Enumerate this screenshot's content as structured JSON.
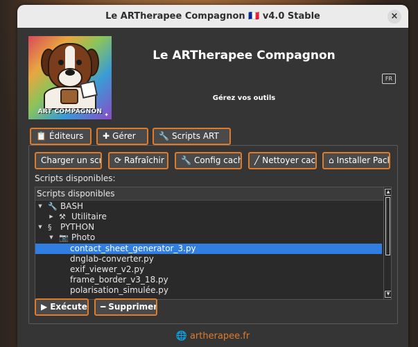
{
  "window": {
    "title": "Le ARTherapee Compagnon 🇫🇷 v4.0 Stable",
    "close_symbol": "×"
  },
  "header": {
    "logo_text": "ART COMPAGNON",
    "app_title": "Le ARTherapee Compagnon",
    "flag_label": "FR",
    "subtitle": "Gérez vos outils"
  },
  "tabs": [
    {
      "label": "Éditeurs",
      "icon": "clipboard-icon",
      "glyph": "📋"
    },
    {
      "label": "Gérer",
      "icon": "plus-icon",
      "glyph": "✚"
    },
    {
      "label": "Scripts ART",
      "icon": "wrench-icon",
      "glyph": "🔧"
    }
  ],
  "toolbar": [
    {
      "label": "Charger un scr",
      "icon": "",
      "glyph": ""
    },
    {
      "label": "Rafraîchir",
      "icon": "refresh-icon",
      "glyph": "⟳"
    },
    {
      "label": "Config cache",
      "icon": "wrench-icon",
      "glyph": "🔧"
    },
    {
      "label": "Nettoyer cach",
      "icon": "broom-icon",
      "glyph": "╱"
    },
    {
      "label": "Installer Pack",
      "icon": "package-icon",
      "glyph": "⌂"
    }
  ],
  "list": {
    "label": "Scripts disponibles:",
    "header": "Scripts disponibles",
    "rows": [
      {
        "text": "BASH",
        "level": 0,
        "arrow": "▼",
        "icon": "wrench-icon",
        "glyph": "🔧",
        "selected": false
      },
      {
        "text": "Utilitaire",
        "level": 1,
        "arrow": "▶",
        "icon": "tools-icon",
        "glyph": "⚒",
        "selected": false
      },
      {
        "text": "PYTHON",
        "level": 0,
        "arrow": "▼",
        "icon": "python-icon",
        "glyph": "§",
        "selected": false
      },
      {
        "text": "Photo",
        "level": 1,
        "arrow": "▼",
        "icon": "camera-icon",
        "glyph": "📷",
        "selected": false
      },
      {
        "text": "contact_sheet_generator_3.py",
        "level": 2,
        "arrow": "",
        "icon": "",
        "glyph": "",
        "selected": true
      },
      {
        "text": "dnglab-converter.py",
        "level": 2,
        "arrow": "",
        "icon": "",
        "glyph": "",
        "selected": false
      },
      {
        "text": "exif_viewer_v2.py",
        "level": 2,
        "arrow": "",
        "icon": "",
        "glyph": "",
        "selected": false
      },
      {
        "text": "frame_border_v3_18.py",
        "level": 2,
        "arrow": "",
        "icon": "",
        "glyph": "",
        "selected": false
      },
      {
        "text": "polarisation_simulée.py",
        "level": 2,
        "arrow": "",
        "icon": "",
        "glyph": "",
        "selected": false
      }
    ],
    "scroll_position": 0.0
  },
  "actions": {
    "execute_label": "Exécuter",
    "execute_glyph": "▶",
    "delete_label": "Supprimer",
    "delete_glyph": "━"
  },
  "footer": {
    "link_text": "artherapee.fr",
    "globe_glyph": "🌐"
  },
  "colors": {
    "accent": "#e07b2a",
    "selection": "#2f7ee0",
    "window_bg": "#353535",
    "titlebar_bg": "#ebebeb"
  }
}
